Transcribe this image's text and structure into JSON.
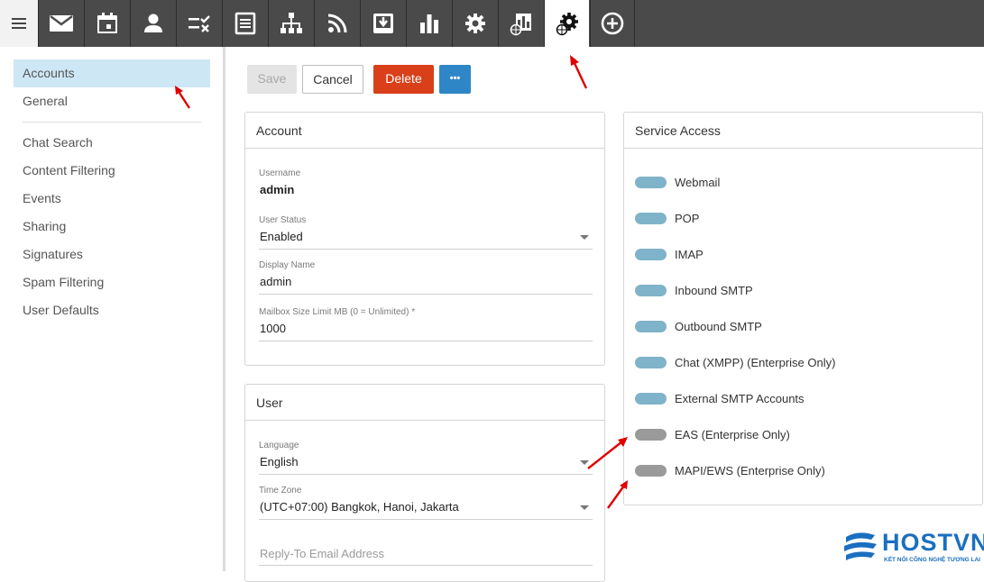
{
  "toolbar": {
    "icons": [
      "menu-icon",
      "mail-icon",
      "calendar-icon",
      "contacts-icon",
      "tasks-icon",
      "notes-icon",
      "org-chart-icon",
      "rss-icon",
      "archive-icon",
      "reports-icon",
      "settings-icon",
      "domain-reports-icon",
      "domain-settings-icon",
      "add-icon"
    ],
    "active": "domain-settings-icon"
  },
  "sidebar": {
    "items": [
      {
        "label": "Accounts",
        "active": true
      },
      {
        "label": "General"
      },
      {
        "label": "Chat Search"
      },
      {
        "label": "Content Filtering"
      },
      {
        "label": "Events"
      },
      {
        "label": "Sharing"
      },
      {
        "label": "Signatures"
      },
      {
        "label": "Spam Filtering"
      },
      {
        "label": "User Defaults"
      }
    ]
  },
  "actions": {
    "save": "Save",
    "cancel": "Cancel",
    "delete": "Delete",
    "more": "•••"
  },
  "account_card": {
    "title": "Account",
    "username_label": "Username",
    "username_value": "admin",
    "status_label": "User Status",
    "status_value": "Enabled",
    "display_label": "Display Name",
    "display_value": "admin",
    "mailbox_label": "Mailbox Size Limit MB (0 = Unlimited) *",
    "mailbox_value": "1000"
  },
  "user_card": {
    "title": "User",
    "language_label": "Language",
    "language_value": "English",
    "timezone_label": "Time Zone",
    "timezone_value": "(UTC+07:00) Bangkok, Hanoi, Jakarta",
    "reply_placeholder": "Reply-To Email Address"
  },
  "service_card": {
    "title": "Service Access",
    "services": [
      {
        "label": "Webmail",
        "enabled": true
      },
      {
        "label": "POP",
        "enabled": true
      },
      {
        "label": "IMAP",
        "enabled": true
      },
      {
        "label": "Inbound SMTP",
        "enabled": true
      },
      {
        "label": "Outbound SMTP",
        "enabled": true
      },
      {
        "label": "Chat (XMPP) (Enterprise Only)",
        "enabled": true
      },
      {
        "label": "External SMTP Accounts",
        "enabled": true
      },
      {
        "label": "EAS (Enterprise Only)",
        "enabled": false
      },
      {
        "label": "MAPI/EWS (Enterprise Only)",
        "enabled": false
      }
    ]
  },
  "watermark": {
    "brand": "HOSTVN",
    "tagline": "KẾT NỐI CÔNG NGHỆ TƯƠNG LAI"
  },
  "colors": {
    "toolbar_bg": "#4a4a4a",
    "active_nav": "#cde7f4",
    "delete_button": "#d9401a",
    "more_button": "#2f86c6",
    "toggle_on": "#7fb3c9",
    "toggle_off": "#9a9a9a",
    "annotation_arrow": "#e00000",
    "watermark_blue": "#1a6fc0"
  }
}
